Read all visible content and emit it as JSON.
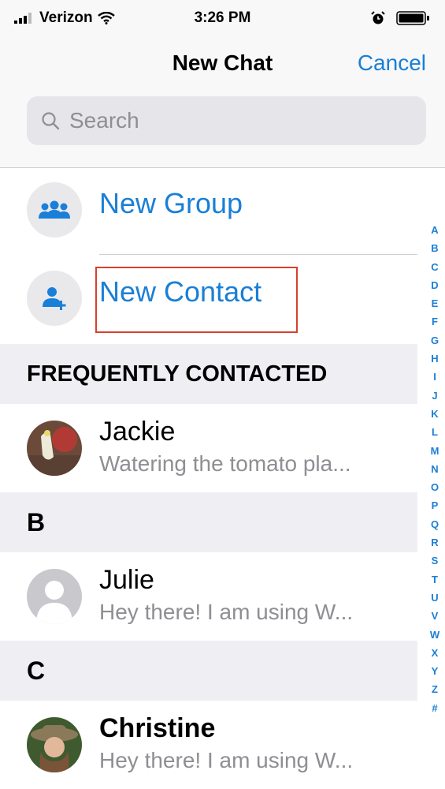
{
  "status_bar": {
    "carrier": "Verizon",
    "time": "3:26 PM",
    "icons": [
      "signal-icon",
      "wifi-icon",
      "alarm-icon",
      "battery-icon"
    ]
  },
  "nav": {
    "title": "New Chat",
    "cancel_label": "Cancel"
  },
  "search": {
    "placeholder": "Search",
    "value": ""
  },
  "actions": {
    "new_group_label": "New Group",
    "new_contact_label": "New Contact",
    "icons": [
      "group-icon",
      "add-contact-icon"
    ]
  },
  "sections": {
    "frequent_header": "FREQUENTLY CONTACTED",
    "b_header": "B",
    "c_header": "C"
  },
  "contacts": [
    {
      "name": "Jackie",
      "status": "Watering the tomato pla..."
    },
    {
      "name": "Julie",
      "status": "Hey there! I am using W..."
    },
    {
      "name": "Christine",
      "status": "Hey there! I am using W..."
    }
  ],
  "index_letters": [
    "A",
    "B",
    "C",
    "D",
    "E",
    "F",
    "G",
    "H",
    "I",
    "J",
    "K",
    "L",
    "M",
    "N",
    "O",
    "P",
    "Q",
    "R",
    "S",
    "T",
    "U",
    "V",
    "W",
    "X",
    "Y",
    "Z",
    "#"
  ],
  "colors": {
    "accent": "#1a7fd6",
    "highlight": "#d9402b",
    "secondary_text": "#8e8e93",
    "section_background": "#efeff3"
  }
}
